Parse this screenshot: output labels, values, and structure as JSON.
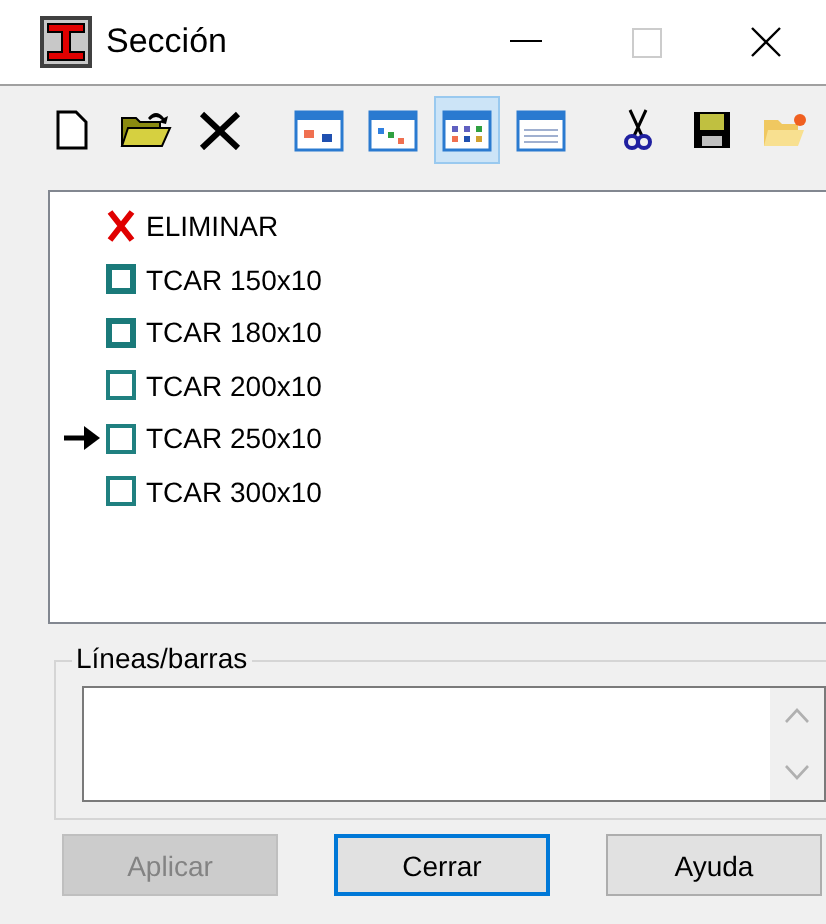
{
  "window": {
    "title": "Sección"
  },
  "toolbar": [
    {
      "kind": "new",
      "selected": false
    },
    {
      "kind": "open",
      "selected": false
    },
    {
      "kind": "delete",
      "selected": false
    },
    {
      "kind": "view-a",
      "selected": false
    },
    {
      "kind": "view-b",
      "selected": false
    },
    {
      "kind": "view-c",
      "selected": true
    },
    {
      "kind": "view-d",
      "selected": false
    },
    {
      "kind": "cut",
      "selected": false
    },
    {
      "kind": "save",
      "selected": false
    },
    {
      "kind": "folder-new",
      "selected": false
    }
  ],
  "list": [
    {
      "kind": "delete",
      "label": "ELIMINAR"
    },
    {
      "kind": "section",
      "label": "TCAR 150x10",
      "highlighted": true,
      "current": false
    },
    {
      "kind": "section",
      "label": "TCAR 180x10",
      "highlighted": true,
      "current": false
    },
    {
      "kind": "section",
      "label": "TCAR 200x10",
      "highlighted": false,
      "current": false
    },
    {
      "kind": "section",
      "label": "TCAR 250x10",
      "highlighted": false,
      "current": true
    },
    {
      "kind": "section",
      "label": "TCAR 300x10",
      "highlighted": false,
      "current": false
    }
  ],
  "group": {
    "title": "Líneas/barras"
  },
  "buttons": [
    {
      "label": "Aplicar",
      "disabled": true,
      "default": false
    },
    {
      "label": "Cerrar",
      "disabled": false,
      "default": true
    },
    {
      "label": "Ayuda",
      "disabled": false,
      "default": false
    }
  ]
}
